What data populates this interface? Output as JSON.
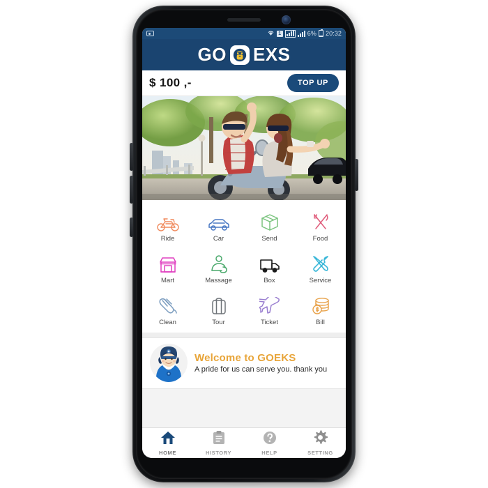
{
  "device": {
    "name": "samsung-galaxy-phone",
    "frame_color": "#0b0c0e"
  },
  "statusbar": {
    "screenshot_icon": "screenshot-icon",
    "wifi_icon": "wifi-icon",
    "notification_badge": "1",
    "signal_icon_1": "signal-bars-boxed-icon",
    "signal_icon_2": "signal-bars-icon",
    "battery_percent": "6%",
    "battery_icon": "battery-low-icon",
    "time": "20:32",
    "background": "#1c4a77"
  },
  "header": {
    "logo_left": "GO",
    "logo_right": "EXS",
    "badge_icon": "scooter-icon",
    "background": "#1a4470"
  },
  "balance": {
    "amount": "$ 100 ,-",
    "topup_label": "TOP UP",
    "topup_color": "#1a4a7a"
  },
  "hero": {
    "alt": "couple-riding-scooter-photo"
  },
  "services": [
    {
      "label": "Ride",
      "icon": "motorcycle-icon",
      "color": "#f08a5d"
    },
    {
      "label": "Car",
      "icon": "car-icon",
      "color": "#4a79c4"
    },
    {
      "label": "Send",
      "icon": "package-box-icon",
      "color": "#7bc47f"
    },
    {
      "label": "Food",
      "icon": "fork-knife-icon",
      "color": "#e05b7a"
    },
    {
      "label": "Mart",
      "icon": "store-icon",
      "color": "#e040c0"
    },
    {
      "label": "Massage",
      "icon": "massage-icon",
      "color": "#4aa96c"
    },
    {
      "label": "Box",
      "icon": "truck-icon",
      "color": "#1b1b1b"
    },
    {
      "label": "Service",
      "icon": "tools-icon",
      "color": "#3ab7d8"
    },
    {
      "label": "Clean",
      "icon": "cleaning-hand-icon",
      "color": "#7d9ec0"
    },
    {
      "label": "Tour",
      "icon": "suitcase-icon",
      "color": "#6e7378"
    },
    {
      "label": "Ticket",
      "icon": "airplane-icon",
      "color": "#9a7fd0"
    },
    {
      "label": "Bill",
      "icon": "coins-icon",
      "color": "#e8a24a"
    }
  ],
  "welcome": {
    "avatar_icon": "driver-avatar-icon",
    "title": "Welcome to GOEKS",
    "title_color": "#e8a53a",
    "subtitle": "A pride for us can serve you. thank you"
  },
  "bottom_nav": [
    {
      "label": "HOME",
      "icon": "home-icon",
      "active": true,
      "color": "#1a4a7a"
    },
    {
      "label": "HISTORY",
      "icon": "clipboard-icon",
      "active": false,
      "color": "#b0b0b0"
    },
    {
      "label": "HELP",
      "icon": "question-circle-icon",
      "active": false,
      "color": "#b0b0b0"
    },
    {
      "label": "SETTING",
      "icon": "gear-icon",
      "active": false,
      "color": "#9a9a9a"
    }
  ]
}
